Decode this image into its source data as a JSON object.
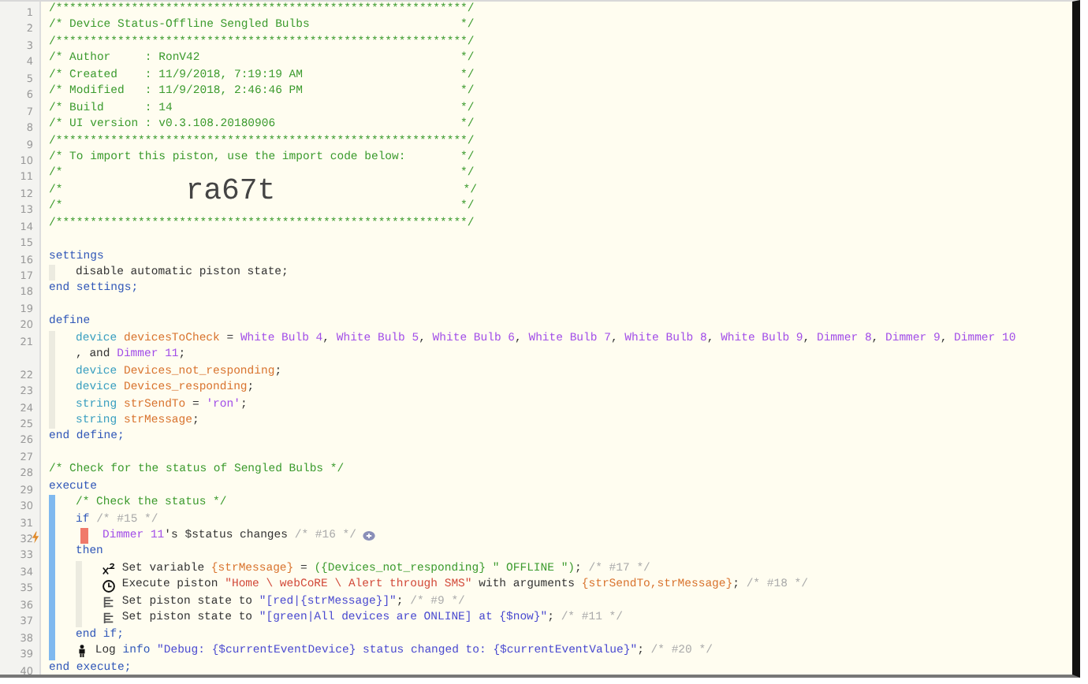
{
  "lines": [
    {
      "number": "1",
      "segments": [
        {
          "kind": "comment",
          "text": "/************************************************************/"
        }
      ]
    },
    {
      "number": "2",
      "segments": [
        {
          "kind": "comment",
          "text": "/* Device Status-Offline Sengled Bulbs                      */"
        }
      ]
    },
    {
      "number": "3",
      "segments": [
        {
          "kind": "comment",
          "text": "/************************************************************/"
        }
      ]
    },
    {
      "number": "4",
      "segments": [
        {
          "kind": "comment",
          "text": "/* Author     : RonV42                                      */"
        }
      ]
    },
    {
      "number": "5",
      "segments": [
        {
          "kind": "comment",
          "text": "/* Created    : 11/9/2018, 7:19:19 AM                       */"
        }
      ]
    },
    {
      "number": "6",
      "segments": [
        {
          "kind": "comment",
          "text": "/* Modified   : 11/9/2018, 2:46:46 PM                       */"
        }
      ]
    },
    {
      "number": "7",
      "segments": [
        {
          "kind": "comment",
          "text": "/* Build      : 14                                          */"
        }
      ]
    },
    {
      "number": "8",
      "segments": [
        {
          "kind": "comment",
          "text": "/* UI version : v0.3.108.20180906                           */"
        }
      ]
    },
    {
      "number": "9",
      "segments": [
        {
          "kind": "comment",
          "text": "/************************************************************/"
        }
      ]
    },
    {
      "number": "10",
      "segments": [
        {
          "kind": "comment",
          "text": "/* To import this piston, use the import code below:        */"
        }
      ]
    },
    {
      "number": "11",
      "segments": [
        {
          "kind": "comment",
          "text": "/*                                                          */"
        }
      ]
    },
    {
      "number": "12",
      "segments": [
        {
          "kind": "comment",
          "text": "/*"
        },
        {
          "kind": "code",
          "text": "ra67t"
        },
        {
          "kind": "comment",
          "text": "*/"
        }
      ]
    },
    {
      "number": "13",
      "segments": [
        {
          "kind": "comment",
          "text": "/*                                                          */"
        }
      ]
    },
    {
      "number": "14",
      "segments": [
        {
          "kind": "comment",
          "text": "/************************************************************/"
        }
      ]
    },
    {
      "number": "15"
    },
    {
      "number": "16",
      "kind": "settings",
      "segments": [
        {
          "kind": "keyword",
          "text": "settings"
        }
      ],
      "children": [
        {
          "number": "17",
          "segments": [
            {
              "kind": "plain",
              "text": "disable automatic piston state;"
            }
          ]
        }
      ]
    },
    {
      "number": "18",
      "segments": [
        {
          "kind": "keyword",
          "text": "end settings;"
        }
      ]
    },
    {
      "number": "19"
    },
    {
      "number": "20",
      "kind": "define",
      "segments": [
        {
          "kind": "keyword",
          "text": "define"
        }
      ],
      "children": [
        {
          "number": "21",
          "segments": [
            {
              "kind": "type",
              "text": "device "
            },
            {
              "kind": "variable",
              "text": "devicesToCheck"
            },
            {
              "kind": "plain",
              "text": " = "
            },
            {
              "kind": "device",
              "text": "White Bulb 4"
            },
            {
              "kind": "plain",
              "text": ", "
            },
            {
              "kind": "device",
              "text": "White Bulb 5"
            },
            {
              "kind": "plain",
              "text": ", "
            },
            {
              "kind": "device",
              "text": "White Bulb 6"
            },
            {
              "kind": "plain",
              "text": ", "
            },
            {
              "kind": "device",
              "text": "White Bulb 7"
            },
            {
              "kind": "plain",
              "text": ", "
            },
            {
              "kind": "device",
              "text": "White Bulb 8"
            },
            {
              "kind": "plain",
              "text": ", "
            },
            {
              "kind": "device",
              "text": "White Bulb 9"
            },
            {
              "kind": "plain",
              "text": ", "
            },
            {
              "kind": "device",
              "text": "Dimmer 8"
            },
            {
              "kind": "plain",
              "text": ", "
            },
            {
              "kind": "device",
              "text": "Dimmer 9"
            },
            {
              "kind": "plain",
              "text": ", "
            },
            {
              "kind": "device",
              "text": "Dimmer 10"
            }
          ]
        },
        {
          "segments": [
            {
              "kind": "plain",
              "text": ", and "
            },
            {
              "kind": "device",
              "text": "Dimmer 11"
            },
            {
              "kind": "plain",
              "text": ";"
            }
          ]
        },
        {
          "number": "22",
          "segments": [
            {
              "kind": "type",
              "text": "device "
            },
            {
              "kind": "variable",
              "text": "Devices_not_responding"
            },
            {
              "kind": "plain",
              "text": ";"
            }
          ]
        },
        {
          "number": "23",
          "segments": [
            {
              "kind": "type",
              "text": "device "
            },
            {
              "kind": "variable",
              "text": "Devices_responding"
            },
            {
              "kind": "plain",
              "text": ";"
            }
          ]
        },
        {
          "number": "24",
          "segments": [
            {
              "kind": "type",
              "text": "string "
            },
            {
              "kind": "variable",
              "text": "strSendTo"
            },
            {
              "kind": "plain",
              "text": " = "
            },
            {
              "kind": "string",
              "text": "'ron'"
            },
            {
              "kind": "plain",
              "text": ";"
            }
          ]
        },
        {
          "number": "25",
          "segments": [
            {
              "kind": "type",
              "text": "string "
            },
            {
              "kind": "variable",
              "text": "strMessage"
            },
            {
              "kind": "plain",
              "text": ";"
            }
          ]
        }
      ]
    },
    {
      "number": "26",
      "segments": [
        {
          "kind": "keyword",
          "text": "end define;"
        }
      ]
    },
    {
      "number": "27"
    },
    {
      "number": "28",
      "segments": [
        {
          "kind": "comment",
          "text": "/* Check for the status of Sengled Bulbs */"
        }
      ]
    },
    {
      "number": "29",
      "kind": "execute",
      "segments": [
        {
          "kind": "keyword",
          "text": "execute"
        }
      ],
      "children": [
        {
          "number": "30",
          "segments": [
            {
              "kind": "comment",
              "text": "/* Check the status */"
            }
          ]
        },
        {
          "number": "31",
          "kind": "if",
          "segments": [
            {
              "kind": "keyword",
              "text": "if "
            },
            {
              "kind": "note",
              "text": "/* #15 */"
            }
          ],
          "children": [
            {
              "number": "32",
              "trigger": true,
              "segments": [
                {
                  "kind": "device",
                  "text": "Dimmer 11"
                },
                {
                  "kind": "plain",
                  "text": "'s $status changes "
                },
                {
                  "kind": "note",
                  "text": "/* #16 */ "
                },
                {
                  "kind": "add"
                }
              ]
            }
          ]
        },
        {
          "number": "33",
          "kind": "then",
          "segments": [
            {
              "kind": "keyword",
              "text": "then"
            }
          ],
          "children": [
            {
              "number": "34",
              "segments": [
                {
                  "kind": "variable-icon"
                },
                {
                  "kind": "plain",
                  "text": " Set variable "
                },
                {
                  "kind": "variable",
                  "text": "{strMessage}"
                },
                {
                  "kind": "plain",
                  "text": " = "
                },
                {
                  "kind": "expression",
                  "text": "({Devices_not_responding} \" OFFLINE \")"
                },
                {
                  "kind": "plain",
                  "text": "; "
                },
                {
                  "kind": "note",
                  "text": "/* #17 */"
                }
              ]
            },
            {
              "number": "35",
              "segments": [
                {
                  "kind": "clock-icon"
                },
                {
                  "kind": "plain",
                  "text": " Execute piston "
                },
                {
                  "kind": "piston",
                  "text": "\"Home \\ webCoRE \\ Alert through SMS\""
                },
                {
                  "kind": "plain",
                  "text": " with arguments "
                },
                {
                  "kind": "variable",
                  "text": "{strSendTo,strMessage}"
                },
                {
                  "kind": "plain",
                  "text": "; "
                },
                {
                  "kind": "note",
                  "text": "/* #18 */"
                }
              ]
            },
            {
              "number": "36",
              "segments": [
                {
                  "kind": "list-icon"
                },
                {
                  "kind": "plain",
                  "text": " Set piston state to "
                },
                {
                  "kind": "text",
                  "text": "\"[red|{strMessage}]\""
                },
                {
                  "kind": "plain",
                  "text": "; "
                },
                {
                  "kind": "note",
                  "text": "/* #9 */"
                }
              ]
            },
            {
              "number": "37",
              "segments": [
                {
                  "kind": "list-icon"
                },
                {
                  "kind": "plain",
                  "text": " Set piston state to "
                },
                {
                  "kind": "text",
                  "text": "\"[green|All devices are ONLINE] at {$now}\""
                },
                {
                  "kind": "plain",
                  "text": "; "
                },
                {
                  "kind": "note",
                  "text": "/* #11 */"
                }
              ]
            }
          ]
        },
        {
          "number": "38",
          "segments": [
            {
              "kind": "keyword",
              "text": "end if;"
            }
          ]
        },
        {
          "number": "39",
          "segments": [
            {
              "kind": "person-icon"
            },
            {
              "kind": "plain",
              "text": " Log "
            },
            {
              "kind": "keyword",
              "text": "info"
            },
            {
              "kind": "text",
              "text": " \"Debug: {$currentEventDevice} status changed to: {$currentEventValue}\""
            },
            {
              "kind": "plain",
              "text": "; "
            },
            {
              "kind": "note",
              "text": "/* #20 */"
            }
          ]
        }
      ]
    },
    {
      "number": "40",
      "segments": [
        {
          "kind": "keyword",
          "text": "end execute;"
        }
      ]
    }
  ]
}
